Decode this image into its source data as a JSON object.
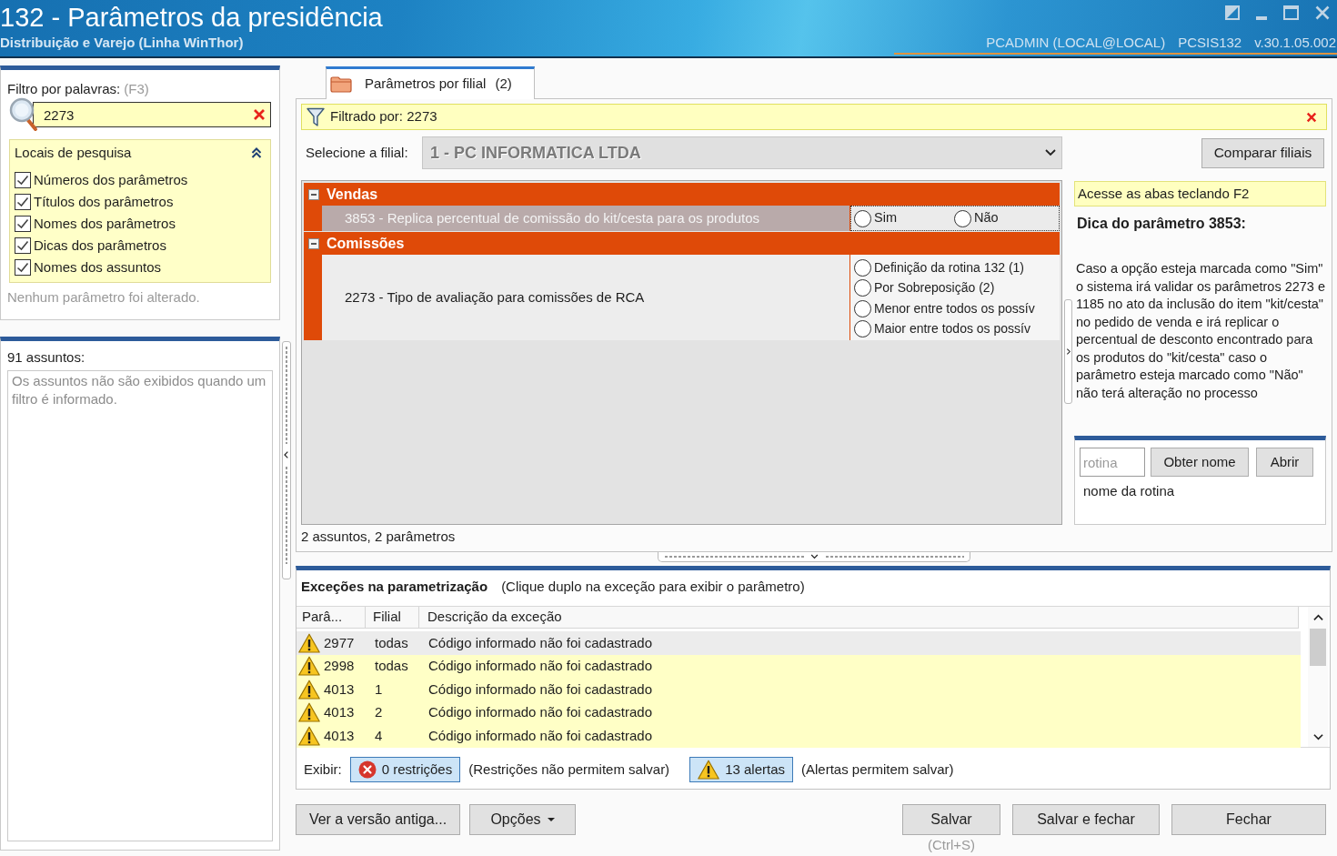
{
  "window": {
    "title": "132 - Parâmetros da presidência",
    "subtitle": "Distribuição e Varejo (Linha WinThor)",
    "user": "PCADMIN (LOCAL@LOCAL)",
    "system": "PCSIS132",
    "version": "v.30.1.05.002"
  },
  "filter_panel": {
    "label": "Filtro por palavras:",
    "shortcut": "(F3)",
    "search": {
      "value": "2273"
    },
    "locations": {
      "title": "Locais de pesquisa",
      "expanded": true,
      "items": [
        {
          "label": "Números dos parâmetros",
          "checked": true
        },
        {
          "label": "Títulos dos parâmetros",
          "checked": true
        },
        {
          "label": "Nomes dos parâmetros",
          "checked": true
        },
        {
          "label": "Dicas dos parâmetros",
          "checked": true
        },
        {
          "label": "Nomes dos assuntos",
          "checked": true
        }
      ]
    },
    "status": "Nenhum parâmetro foi alterado."
  },
  "subjects_panel": {
    "count": "91 assuntos:",
    "message": "Os assuntos não são exibidos quando um filtro é informado."
  },
  "tabs": [
    {
      "label": "Parâmetros por filial",
      "count": "(2)",
      "selected": true
    }
  ],
  "filter_bar": {
    "text": "Filtrado por: 2273"
  },
  "branch_selector": {
    "label": "Selecione a filial:",
    "value": "1 - PC INFORMATICA LTDA",
    "disabled": true
  },
  "compare_button": {
    "label": "Comparar filiais"
  },
  "groups": [
    {
      "title": "Vendas",
      "expanded": true,
      "params": [
        {
          "name": "3853 - Replica percentual de comissão do kit/cesta para os produtos",
          "selected": true,
          "kind": "inline",
          "options": [
            {
              "label": "Sim",
              "selected": false
            },
            {
              "label": "Não",
              "selected": false
            }
          ]
        }
      ]
    },
    {
      "title": "Comissões",
      "expanded": true,
      "params": [
        {
          "name": "2273 - Tipo de avaliação para comissões de RCA",
          "selected": false,
          "kind": "list",
          "options": [
            {
              "label": "Definição da rotina 132 (1)",
              "selected": false
            },
            {
              "label": "Por Sobreposição (2)",
              "selected": false
            },
            {
              "label": "Menor entre todos os possív",
              "selected": false
            },
            {
              "label": "Maior entre todos os possív",
              "selected": false
            }
          ]
        }
      ]
    }
  ],
  "grid_summary": "2 assuntos, 2 parâmetros",
  "hint_panel": {
    "banner": "Acesse as abas teclando F2",
    "title": "Dica do parâmetro 3853:",
    "text": "Caso a opção esteja marcada como \"Sim\" o sistema irá validar os parâmetros 2273 e 1185 no ato da inclusão do item \"kit/cesta\" no pedido de venda e irá replicar o percentual de desconto encontrado para os produtos do \"kit/cesta\" caso o parâmetro esteja marcado como \"Não\" não terá alteração no processo"
  },
  "routine_panel": {
    "placeholder": "rotina",
    "buttons": [
      "Obter nome",
      "Abrir"
    ],
    "name": "nome da rotina"
  },
  "exceptions": {
    "title": "Exceções na parametrização",
    "hint": "(Clique duplo na exceção para exibir o parâmetro)",
    "columns": [
      "Parâ...",
      "Filial",
      "Descrição da exceção"
    ],
    "rows": [
      {
        "kind": "alert",
        "param": "2977",
        "branch": "todas",
        "description": "Código informado não foi cadastrado",
        "selected": true
      },
      {
        "kind": "alert",
        "param": "2998",
        "branch": "todas",
        "description": "Código informado não foi cadastrado",
        "selected": false
      },
      {
        "kind": "alert",
        "param": "4013",
        "branch": "1",
        "description": "Código informado não foi cadastrado",
        "selected": false
      },
      {
        "kind": "alert",
        "param": "4013",
        "branch": "2",
        "description": "Código informado não foi cadastrado",
        "selected": false
      },
      {
        "kind": "alert",
        "param": "4013",
        "branch": "4",
        "description": "Código informado não foi cadastrado",
        "selected": false
      }
    ],
    "show_label": "Exibir:",
    "toggles": [
      {
        "kind": "restriction",
        "label": "0 restrições",
        "note": "(Restrições não permitem salvar)",
        "on": true
      },
      {
        "kind": "alert",
        "label": "13 alertas",
        "note": "(Alertas permitem salvar)",
        "on": true
      }
    ]
  },
  "footer": {
    "left": [
      {
        "label": "Ver a versão antiga...",
        "kind": "plain"
      },
      {
        "label": "Opções",
        "kind": "menu"
      }
    ],
    "right": [
      {
        "label": "Salvar",
        "kind": "plain",
        "shortcut": "(Ctrl+S)"
      },
      {
        "label": "Salvar e fechar",
        "kind": "plain"
      },
      {
        "label": "Fechar",
        "kind": "plain"
      }
    ]
  }
}
